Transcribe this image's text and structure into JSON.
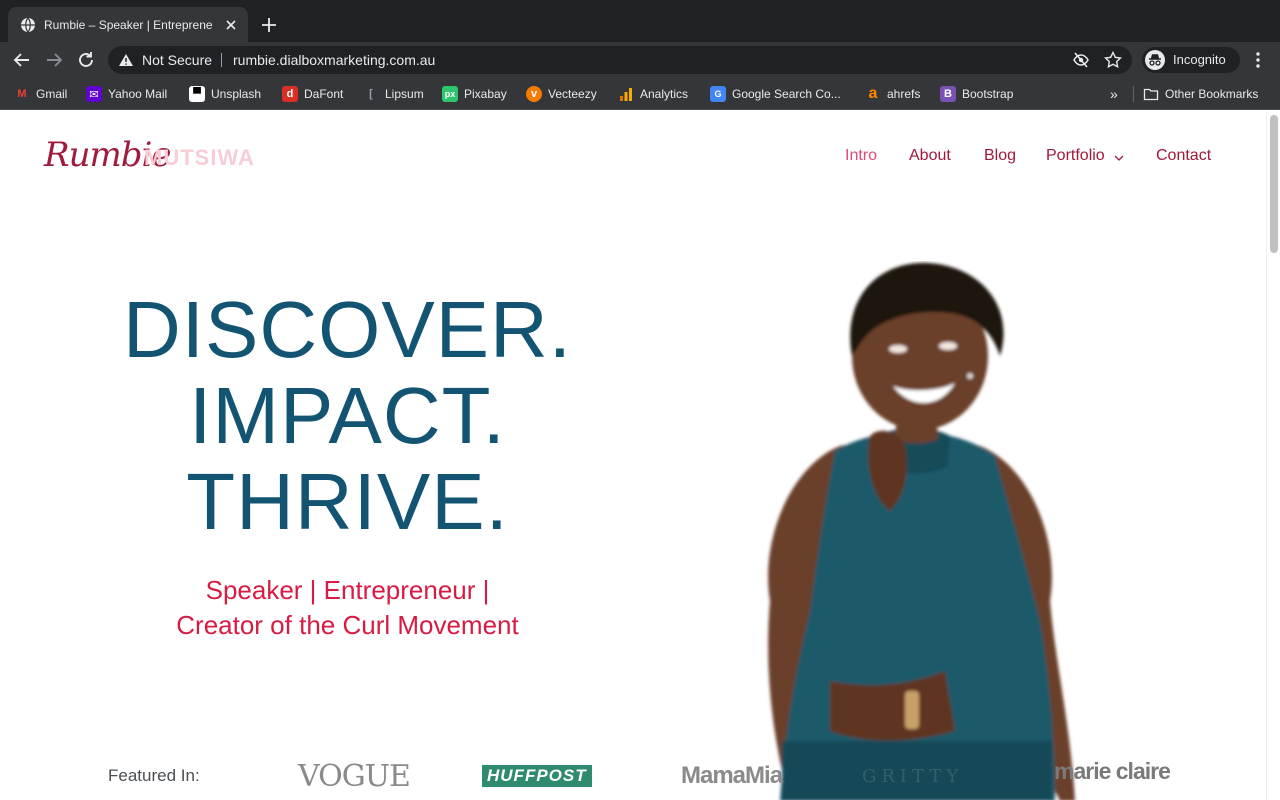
{
  "browser": {
    "tab_title": "Rumbie – Speaker | Entreprene",
    "security_label": "Not Secure",
    "url": "rumbie.dialboxmarketing.com.au",
    "profile_label": "Incognito",
    "bookmarks": [
      {
        "label": "Gmail",
        "icon": "gmail-icon",
        "color": "#ea4335"
      },
      {
        "label": "Yahoo Mail",
        "icon": "yahoo-mail-icon",
        "color": "#6001d2"
      },
      {
        "label": "Unsplash",
        "icon": "unsplash-icon",
        "color": "#ffffff"
      },
      {
        "label": "DaFont",
        "icon": "dafont-icon",
        "color": "#d93025"
      },
      {
        "label": "Lipsum",
        "icon": "lipsum-icon",
        "color": "#9aa0a6"
      },
      {
        "label": "Pixabay",
        "icon": "pixabay-icon",
        "color": "#2ec66d"
      },
      {
        "label": "Vecteezy",
        "icon": "vecteezy-icon",
        "color": "#f57c00"
      },
      {
        "label": "Analytics",
        "icon": "analytics-icon",
        "color": "#f9ab00"
      },
      {
        "label": "Google Search Co...",
        "icon": "search-console-icon",
        "color": "#4285f4"
      },
      {
        "label": "ahrefs",
        "icon": "ahrefs-icon",
        "color": "#ff8800"
      },
      {
        "label": "Bootstrap",
        "icon": "bootstrap-icon",
        "color": "#7952b3"
      }
    ],
    "more_label": "»",
    "other_bookmarks_label": "Other Bookmarks"
  },
  "site": {
    "logo_script": "Rumbie",
    "logo_caps": "MUTSIWA",
    "nav": [
      {
        "label": "Intro",
        "active": true
      },
      {
        "label": "About",
        "active": false
      },
      {
        "label": "Blog",
        "active": false
      },
      {
        "label": "Portfolio",
        "active": false,
        "has_dropdown": true
      },
      {
        "label": "Contact",
        "active": false
      }
    ],
    "headline": [
      "DISCOVER.",
      "IMPACT.",
      "THRIVE."
    ],
    "subline": [
      "Speaker | Entrepreneur |",
      "Creator of the Curl Movement"
    ],
    "featured_label": "Featured In:",
    "press_logos": [
      "VOGUE",
      "HUFFPOST",
      "MamaMia",
      "GRITTY",
      "marie claire"
    ],
    "colors": {
      "headline": "#135473",
      "subline": "#d81b43",
      "nav": "#9e1a3a",
      "nav_active": "#e04a74",
      "dress": "#1e5a6b"
    }
  }
}
